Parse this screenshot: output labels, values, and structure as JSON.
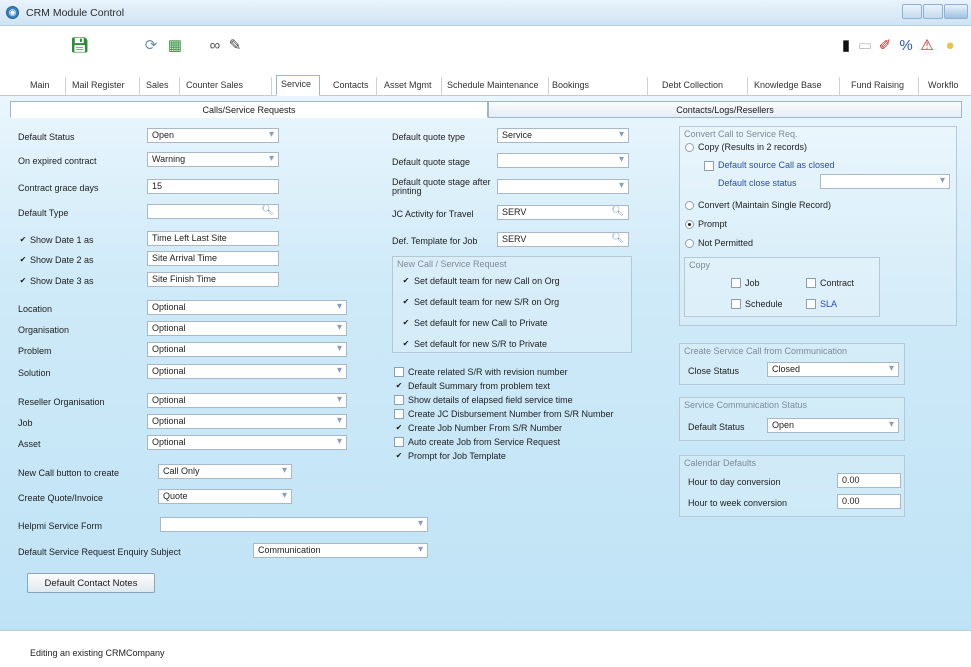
{
  "window": {
    "title": "CRM Module Control"
  },
  "module_tabs": [
    "Main",
    "Mail Register",
    "Sales",
    "Counter Sales",
    "Service",
    "Contacts",
    "Asset Mgmt",
    "Schedule Maintenance",
    "Bookings",
    "Debt Collection",
    "Knowledge Base",
    "Fund Raising",
    "Workflo"
  ],
  "active_tab": "Service",
  "sub_tabs": [
    "Calls/Service Requests",
    "Contacts/Logs/Resellers"
  ],
  "left": {
    "default_status": {
      "label": "Default Status",
      "value": "Open"
    },
    "on_expired_contract": {
      "label": "On expired contract",
      "value": "Warning"
    },
    "contract_grace_days": {
      "label": "Contract grace days",
      "value": "15"
    },
    "default_type": {
      "label": "Default Type",
      "value": ""
    },
    "show_date_1": {
      "label": "Show Date 1 as",
      "value": "Time Left Last Site",
      "checked": true
    },
    "show_date_2": {
      "label": "Show Date 2 as",
      "value": "Site Arrival Time",
      "checked": true
    },
    "show_date_3": {
      "label": "Show Date 3 as",
      "value": "Site Finish Time",
      "checked": true
    },
    "location": {
      "label": "Location",
      "value": "Optional"
    },
    "organisation": {
      "label": "Organisation",
      "value": "Optional"
    },
    "problem": {
      "label": "Problem",
      "value": "Optional"
    },
    "solution": {
      "label": "Solution",
      "value": "Optional"
    },
    "reseller_organisation": {
      "label": "Reseller Organisation",
      "value": "Optional"
    },
    "job": {
      "label": "Job",
      "value": "Optional"
    },
    "asset": {
      "label": "Asset",
      "value": "Optional"
    },
    "new_call_button": {
      "label": "New Call button to create",
      "value": "Call Only"
    },
    "create_quote": {
      "label": "Create Quote/Invoice",
      "value": "Quote"
    },
    "helpmi_form": {
      "label": "Helpmi Service Form",
      "value": ""
    },
    "enquiry_subject": {
      "label": "Default Service Request Enquiry Subject",
      "value": "Communication"
    },
    "contact_notes_button": "Default Contact Notes"
  },
  "middle": {
    "default_quote_type": {
      "label": "Default quote type",
      "value": "Service"
    },
    "default_quote_stage": {
      "label": "Default quote stage",
      "value": ""
    },
    "default_quote_stage_printing": {
      "label": "Default quote stage after printing",
      "value": ""
    },
    "jc_activity_travel": {
      "label": "JC Activity for Travel",
      "value": "SERV"
    },
    "def_template_job": {
      "label": "Def. Template for Job",
      "value": "SERV"
    },
    "new_call_group": {
      "title": "New Call / Service Request",
      "items": [
        {
          "label": "Set default team for new Call on Org",
          "checked": true
        },
        {
          "label": "Set default team for new S/R on Org",
          "checked": true
        },
        {
          "label": "Set default for new Call to Private",
          "checked": true
        },
        {
          "label": "Set default for new S/R to Private",
          "checked": true
        }
      ]
    },
    "options": [
      {
        "label": "Create related S/R with revision number",
        "checked": false
      },
      {
        "label": "Default Summary from problem text",
        "checked": true
      },
      {
        "label": "Show details of elapsed field service time",
        "checked": false
      },
      {
        "label": "Create JC Disbursement Number from S/R Number",
        "checked": false
      },
      {
        "label": "Create Job Number From S/R Number",
        "checked": true
      },
      {
        "label": "Auto create Job from Service Request",
        "checked": false
      },
      {
        "label": "Prompt for Job Template",
        "checked": true
      }
    ]
  },
  "right": {
    "convert_group": {
      "title": "Convert Call to Service Req.",
      "copy_option": "Copy (Results in 2 records)",
      "default_source_closed": "Default source Call as closed",
      "default_close_status_label": "Default close status",
      "default_close_status_value": "",
      "convert_option": "Convert (Maintain Single Record)",
      "prompt_option": "Prompt",
      "not_permitted_option": "Not Permitted",
      "selected": "Prompt",
      "copy_title": "Copy",
      "copy_items": [
        "Job",
        "Contract",
        "Schedule",
        "SLA"
      ]
    },
    "create_from_comm": {
      "title": "Create Service Call from Communication",
      "close_status_label": "Close Status",
      "close_status_value": "Closed"
    },
    "service_comm_status": {
      "title": "Service Communication Status",
      "default_status_label": "Default Status",
      "default_status_value": "Open"
    },
    "calendar_defaults": {
      "title": "Calendar Defaults",
      "hour_day_label": "Hour to day conversion",
      "hour_day_value": "0.00",
      "hour_week_label": "Hour to week conversion",
      "hour_week_value": "0.00"
    }
  },
  "status_bar": "Editing an existing CRMCompany"
}
